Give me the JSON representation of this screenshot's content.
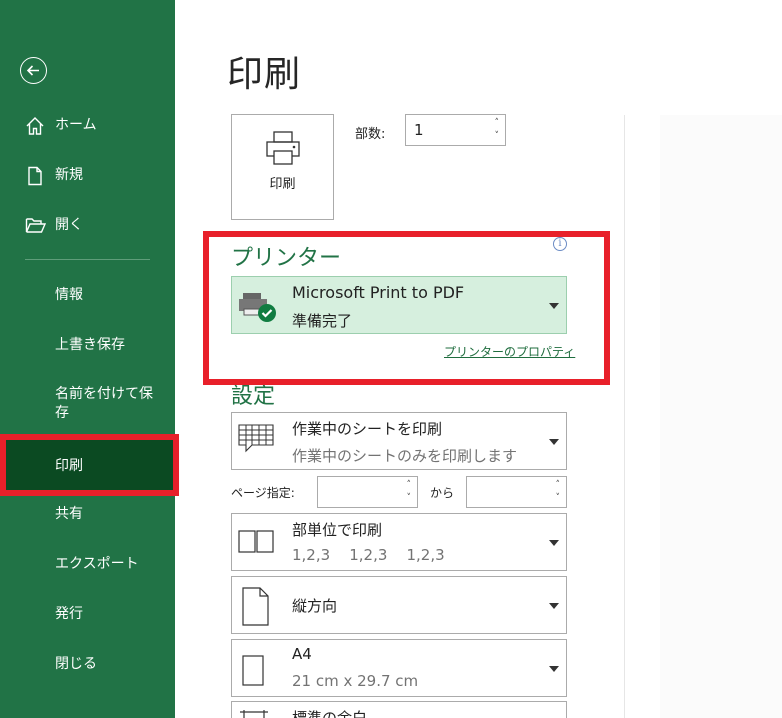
{
  "sidebar": {
    "items": [
      {
        "label": "ホーム",
        "icon": "home-icon"
      },
      {
        "label": "新規",
        "icon": "new-document-icon"
      },
      {
        "label": "開く",
        "icon": "open-folder-icon"
      },
      {
        "label": "情報"
      },
      {
        "label": "上書き保存"
      },
      {
        "label": "名前を付けて保存"
      },
      {
        "label": "印刷",
        "selected": true
      },
      {
        "label": "共有"
      },
      {
        "label": "エクスポート"
      },
      {
        "label": "発行"
      },
      {
        "label": "閉じる"
      }
    ],
    "back_icon": "back-arrow-icon",
    "colors": {
      "background": "#217346",
      "selected": "#0b4a22",
      "highlight": "#e8202a"
    }
  },
  "main": {
    "title": "印刷",
    "print_button": {
      "label": "印刷",
      "icon": "printer-icon"
    },
    "copies": {
      "label": "部数:",
      "value": "1"
    },
    "printer": {
      "section_title": "プリンター",
      "name": "Microsoft Print to PDF",
      "status": "準備完了",
      "properties_link": "プリンターのプロパティ",
      "icon": "printer-ready-icon"
    },
    "settings": {
      "section_title": "設定",
      "print_what": {
        "title": "作業中のシートを印刷",
        "subtitle": "作業中のシートのみを印刷します",
        "icon": "sheet-grid-icon"
      },
      "pages": {
        "label": "ページ指定:",
        "from": "",
        "to_label": "から",
        "to": ""
      },
      "collate": {
        "title": "部単位で印刷",
        "subtitle": "1,2,3    1,2,3    1,2,3",
        "icon": "collate-icon"
      },
      "orientation": {
        "title": "縦方向",
        "icon": "portrait-page-icon"
      },
      "paper": {
        "title": "A4",
        "subtitle": "21 cm x 29.7 cm",
        "icon": "paper-size-icon"
      },
      "margins": {
        "title": "標準の余白",
        "icon": "margins-icon"
      }
    }
  }
}
